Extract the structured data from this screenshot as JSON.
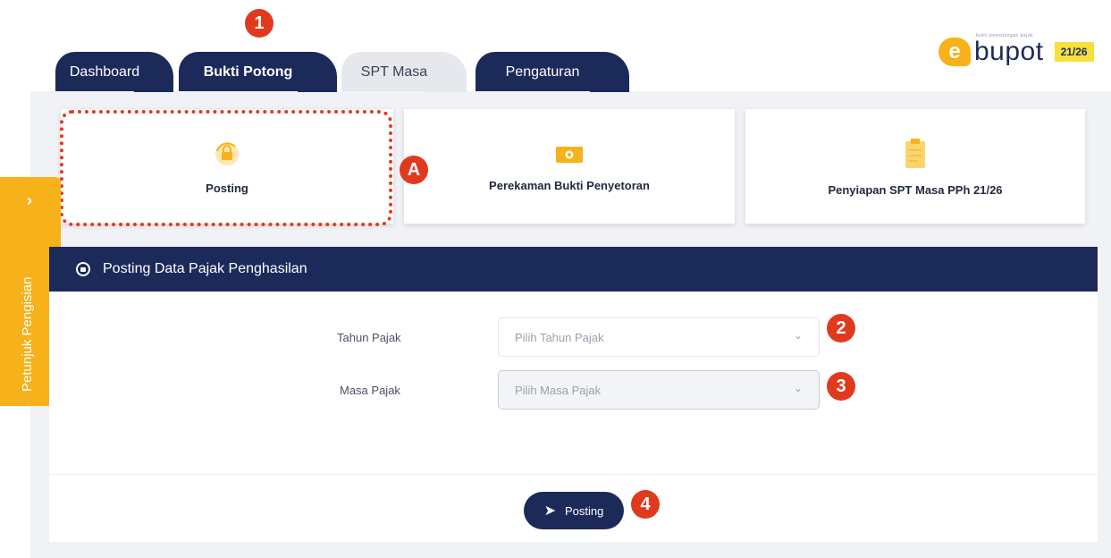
{
  "tabs": [
    {
      "label": "Dashboard"
    },
    {
      "label": "Bukti Potong"
    },
    {
      "label": "SPT Masa"
    },
    {
      "label": "Pengaturan"
    }
  ],
  "logo": {
    "letter": "e",
    "text": "bupot",
    "tagline": "bukti pemotongan pajak",
    "badge": "21/26"
  },
  "cards": [
    {
      "label": "Posting",
      "icon": "lock-refresh-icon"
    },
    {
      "label": "Perekaman Bukti Penyetoran",
      "icon": "money-icon"
    },
    {
      "label": "Penyiapan SPT Masa PPh 21/26",
      "icon": "clipboard-icon"
    }
  ],
  "side_tab": {
    "label": "Petunjuk Pengisian",
    "icon": "chevron-right-icon"
  },
  "form": {
    "title": "Posting Data Pajak Penghasilan",
    "tahun_label": "Tahun Pajak",
    "tahun_placeholder": "Pilih Tahun Pajak",
    "masa_label": "Masa Pajak",
    "masa_placeholder": "Pilih Masa Pajak",
    "submit_label": "Posting"
  },
  "markers": [
    "1",
    "A",
    "2",
    "3",
    "4"
  ],
  "colors": {
    "navy": "#1c2a5a",
    "accent": "#f7b11a",
    "marker": "#e03a1e"
  }
}
